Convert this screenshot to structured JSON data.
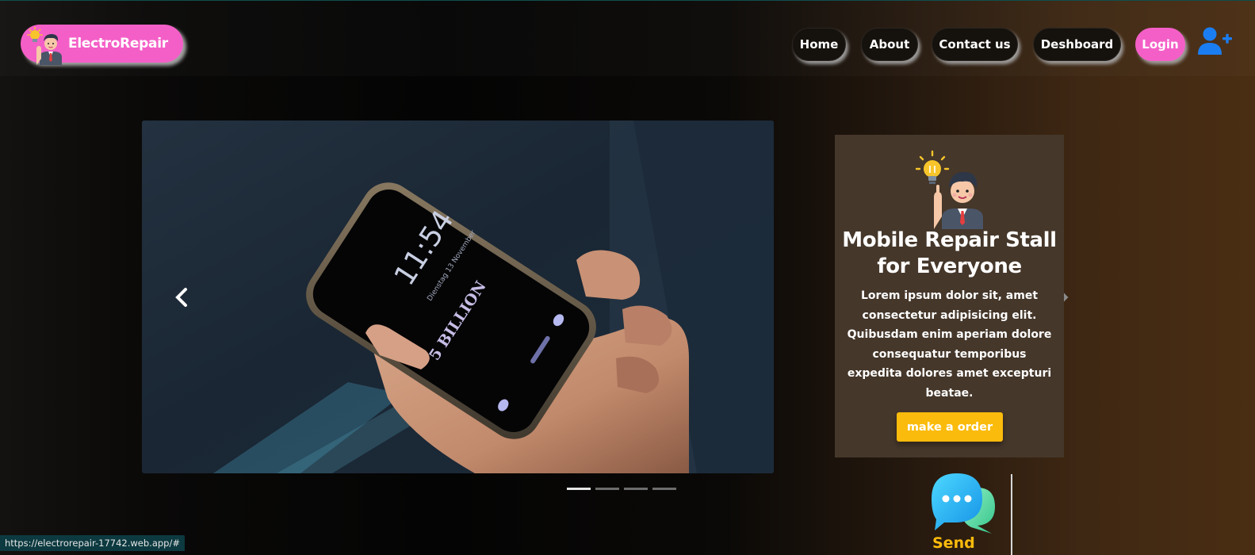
{
  "brand": {
    "name": "ElectroRepair"
  },
  "nav": {
    "home": "Home",
    "about": "About",
    "contact": "Contact us",
    "dashboard": "Deshboard",
    "login": "Login",
    "add_user_icon": "user-plus-icon"
  },
  "carousel": {
    "screen_time": "11:54",
    "screen_date": "Dienstag 13 November",
    "screen_text": "5 BILLION",
    "prev_icon": "chevron-left-icon",
    "next_icon": "chevron-right-icon",
    "slide_count": 4,
    "active_slide": 1
  },
  "card": {
    "title": "Mobile Repair Stall for Everyone",
    "text": "Lorem ipsum dolor sit, amet consectetur adipisicing elit. Quibusdam enim aperiam dolore consequatur temporibus expedita dolores amet excepturi beatae.",
    "button": "make a order"
  },
  "chat": {
    "icon": "chat-bubbles-icon",
    "send_label": "Send"
  },
  "status_bar": {
    "url": "https://electrorepair-17742.web.app/#"
  },
  "colors": {
    "brand_pink": "#f45fc7",
    "accent_yellow": "#fbbb0c",
    "user_icon_blue": "#1b7df2",
    "card_bg": "#45372a"
  }
}
